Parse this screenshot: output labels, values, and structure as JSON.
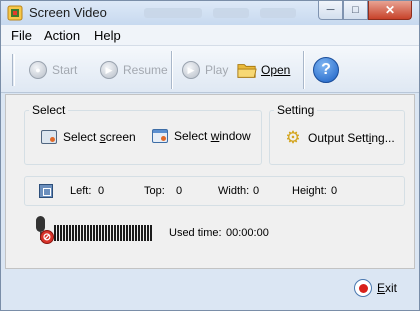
{
  "window": {
    "title": "Screen Video"
  },
  "menu": [
    "File",
    "Action",
    "Help"
  ],
  "toolbar": {
    "start": "Start",
    "resume": "Resume",
    "play": "Play",
    "open": "Open"
  },
  "select_group": {
    "label": "Select",
    "screen_prefix": "Select ",
    "screen_accel": "s",
    "screen_rest": "creen",
    "window_prefix": "Select ",
    "window_accel": "w",
    "window_rest": "indow"
  },
  "setting_group": {
    "label": "Setting",
    "output_prefix": "Output Sett",
    "output_accel": "i",
    "output_rest": "ng..."
  },
  "region": {
    "left_label": "Left:",
    "left_value": "0",
    "top_label": "Top:",
    "top_value": "0",
    "width_label": "Width:",
    "width_value": "0",
    "height_label": "Height:",
    "height_value": "0"
  },
  "status": {
    "used_label": "Used time:",
    "used_value": "00:00:00"
  },
  "footer": {
    "exit_accel": "E",
    "exit_rest": "xit"
  },
  "colors": {
    "window_bg": "#dbe6f3",
    "client_bg": "#f0f0f0",
    "accent": "#1a5fc4",
    "record": "#d8201a"
  }
}
